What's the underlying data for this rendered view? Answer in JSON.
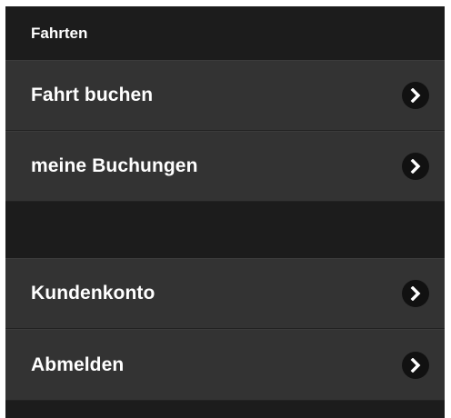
{
  "menu": {
    "group_title": "Fahrten",
    "items": [
      {
        "label": "Fahrt buchen",
        "icon": "chevron-right-icon"
      },
      {
        "label": "meine Buchungen",
        "icon": "chevron-right-icon"
      }
    ],
    "items2": [
      {
        "label": "Kundenkonto",
        "icon": "chevron-right-icon"
      },
      {
        "label": "Abmelden",
        "icon": "chevron-right-icon"
      }
    ]
  },
  "colors": {
    "header_bg": "#1c1c1c",
    "item_bg": "#333333",
    "text": "#ffffff",
    "chevron_bg": "#111111"
  }
}
